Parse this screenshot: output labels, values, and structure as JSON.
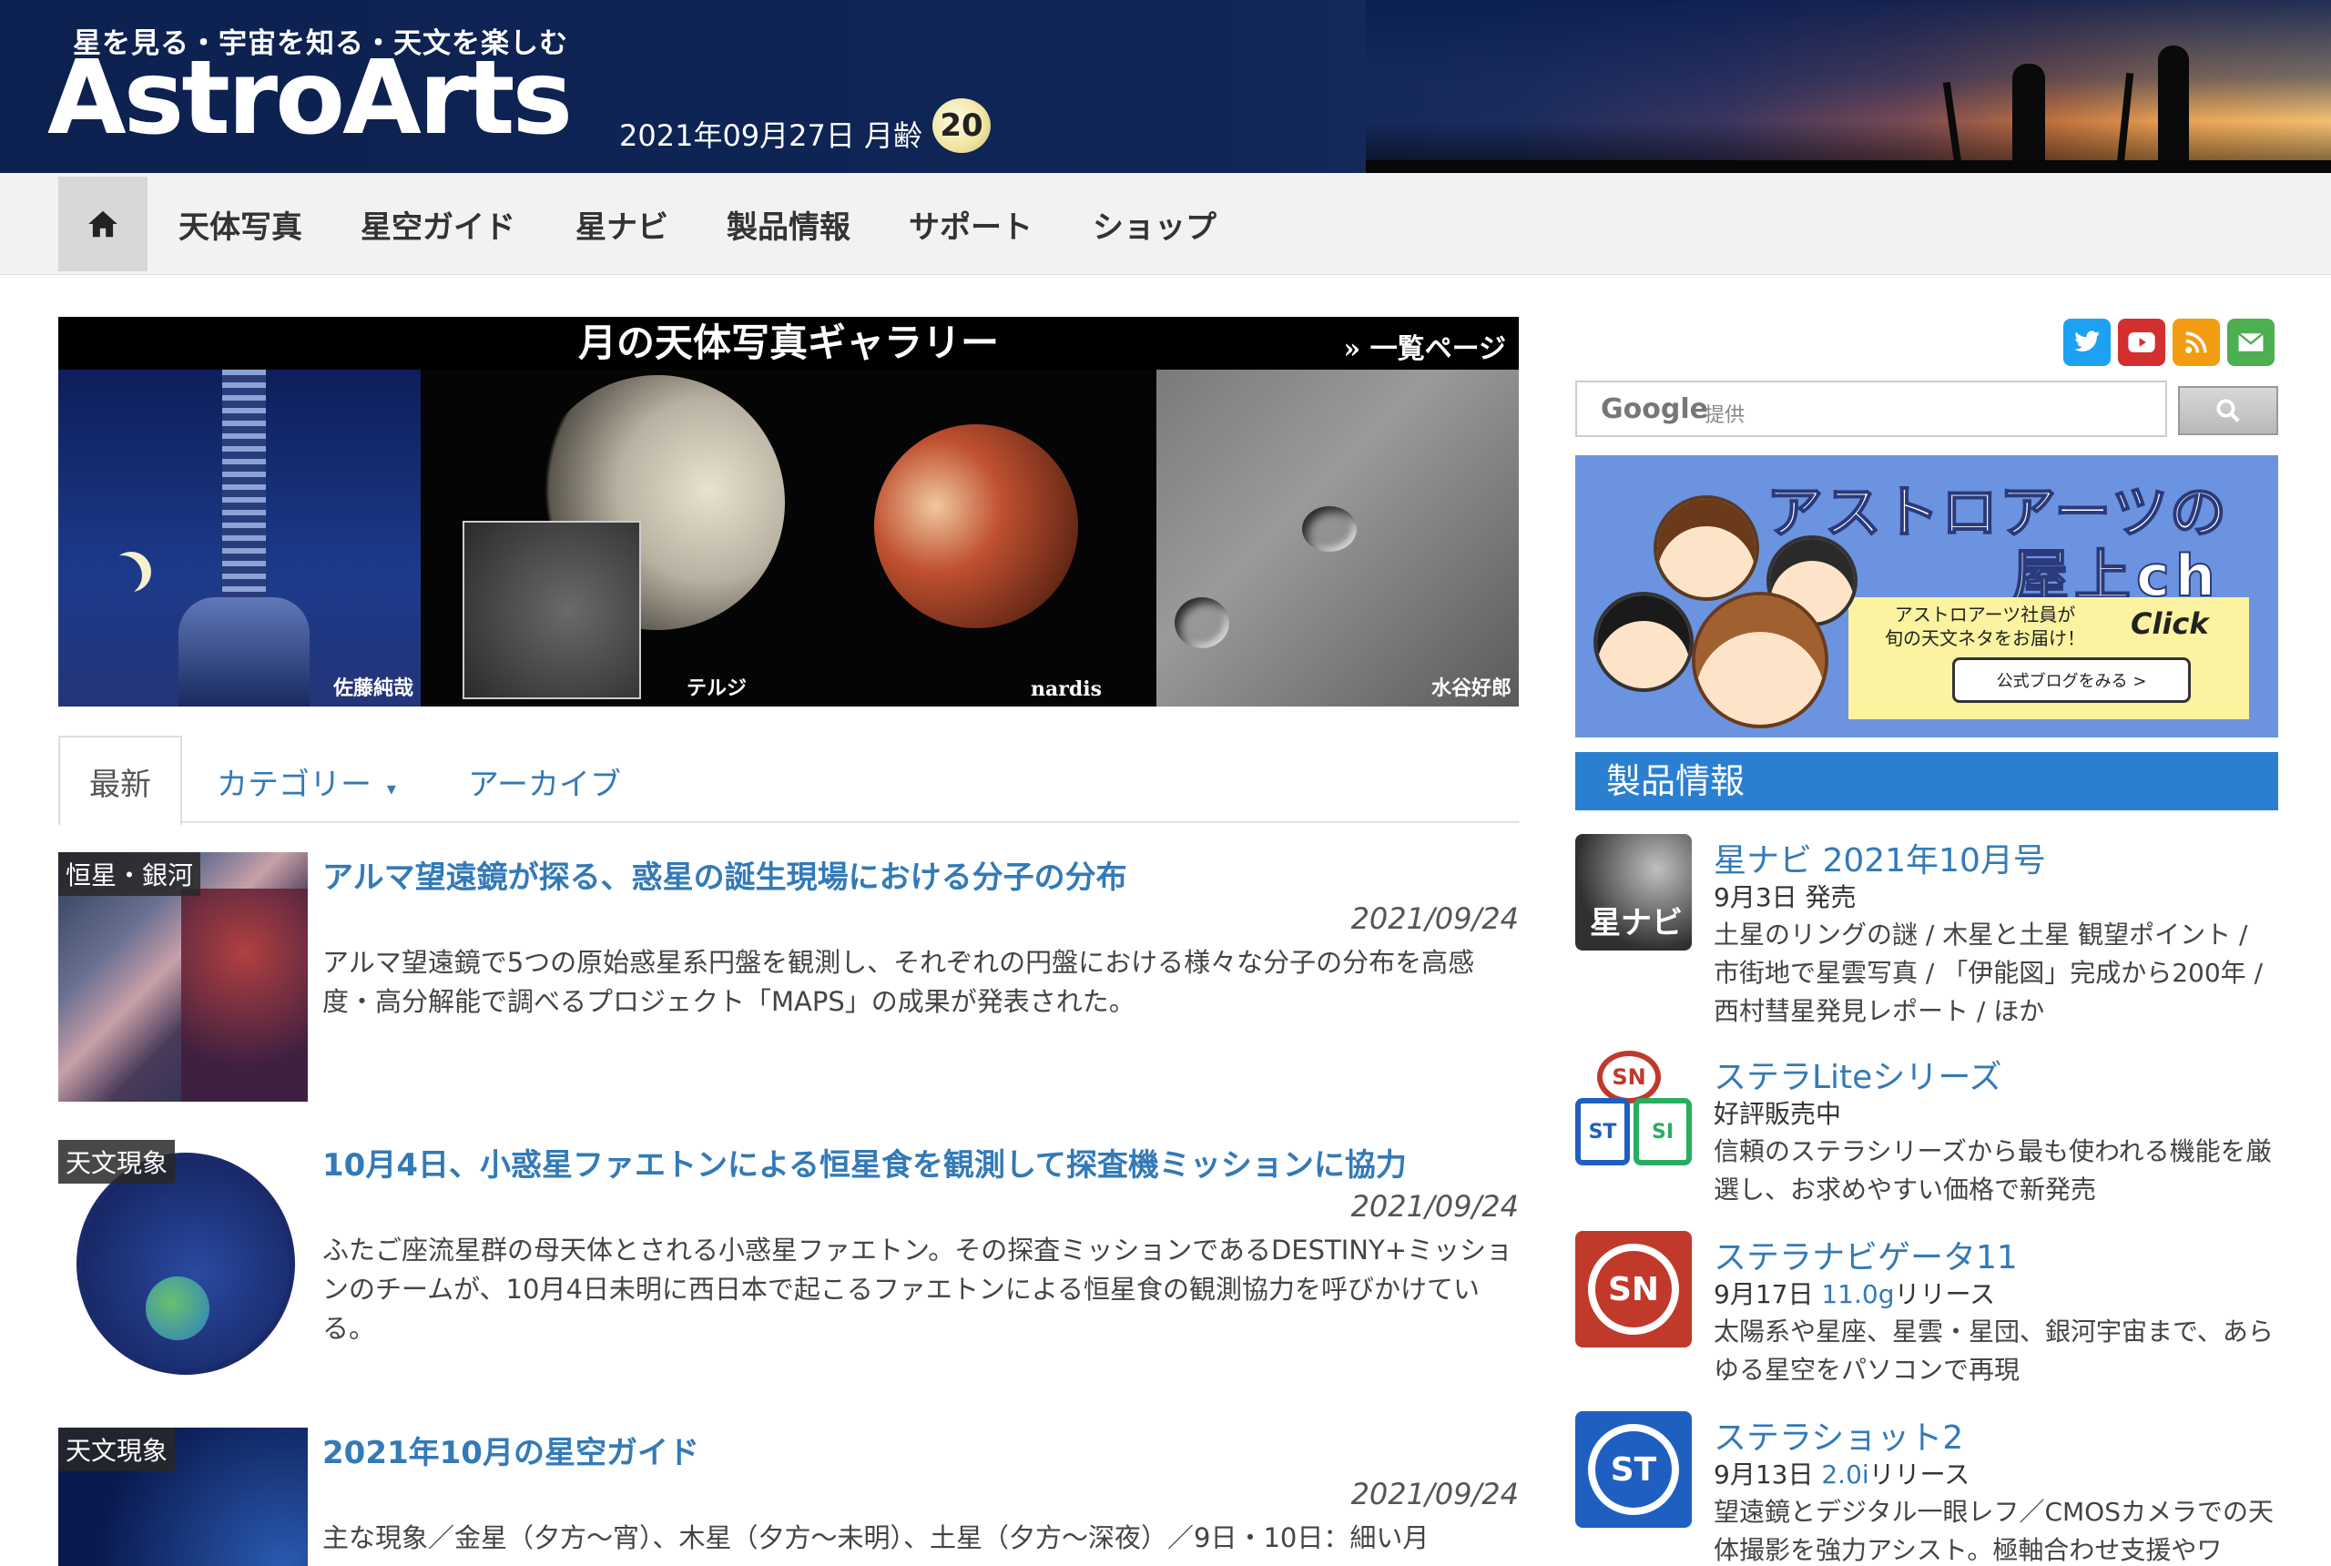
{
  "header": {
    "tagline": "星を見る・宇宙を知る・天文を楽しむ",
    "logo": "AstroArts",
    "date": "2021年09月27日 月齢",
    "moon_age": "20"
  },
  "nav": {
    "home_icon": "home-icon",
    "items": [
      "天体写真",
      "星空ガイド",
      "星ナビ",
      "製品情報",
      "サポート",
      "ショップ"
    ]
  },
  "banner": {
    "title": "月の天体写真ギャラリー",
    "more": "» 一覧ページ",
    "credits": [
      "佐藤純哉",
      "テルジ",
      "nardis",
      "水谷好郎"
    ]
  },
  "tabs": {
    "latest": "最新",
    "category": "カテゴリー",
    "archive": "アーカイブ"
  },
  "articles": [
    {
      "category": "恒星・銀河",
      "title": "アルマ望遠鏡が探る、惑星の誕生現場における分子の分布",
      "date": "2021/09/24",
      "text": "アルマ望遠鏡で5つの原始惑星系円盤を観測し、それぞれの円盤における様々な分子の分布を高感度・高分解能で調べるプロジェクト「MAPS」の成果が発表された。"
    },
    {
      "category": "天文現象",
      "title": "10月4日、小惑星ファエトンによる恒星食を観測して探査機ミッションに協力",
      "date": "2021/09/24",
      "text": "ふたご座流星群の母天体とされる小惑星ファエトン。その探査ミッションであるDESTINY+ミッションのチームが、10月4日未明に西日本で起こるファエトンによる恒星食の観測協力を呼びかけている。"
    },
    {
      "category": "天文現象",
      "title": "2021年10月の星空ガイド",
      "date": "2021/09/24",
      "text": "主な現象／金星（夕方～宵）、木星（夕方～未明）、土星（夕方～深夜）／9日・10日：細い月"
    }
  ],
  "sidebar": {
    "social": [
      "twitter-icon",
      "youtube-icon",
      "rss-icon",
      "mail-icon"
    ],
    "search": {
      "brand": "Google",
      "provided": "提供"
    },
    "ad": {
      "title_line1": "アストロアーツの",
      "title_line2": "屋上ch",
      "sub_line1": "アストロアーツ社員が",
      "sub_line2": "旬の天文ネタをお届け！",
      "click": "Click",
      "button": "公式ブログをみる >"
    },
    "products_heading": "製品情報",
    "products": [
      {
        "title": "星ナビ 2021年10月号",
        "date": "9月3日 発売",
        "version": "",
        "suffix": "",
        "desc": "土星のリング​の謎 / 木星と土星 観望ポイント / 市街地で星雲写真 / 「伊能図」完成から200年 / 西村彗星発見レポート / ほか"
      },
      {
        "title": "ステラLiteシリーズ",
        "date": "好評販売中",
        "version": "",
        "suffix": "",
        "desc": "信頼のステラシリーズから最も使われる機能を厳選し、お求めやすい価格で新発売"
      },
      {
        "title": "ステラナビゲータ11",
        "date": "9月17日 ",
        "version": "11.0g",
        "suffix": "リリース",
        "desc": "太陽系や星座、星雲・星団、銀河宇宙まで、あらゆる星空をパソコンで再現"
      },
      {
        "title": "ステラショット2",
        "date": "9月13日 ",
        "version": "2.0i",
        "suffix": "リリース",
        "desc": "望遠鏡とデジタル一眼レフ／CMOSカメラでの天体撮影を強力アシスト。極軸合わせ支援やワ"
      }
    ]
  }
}
